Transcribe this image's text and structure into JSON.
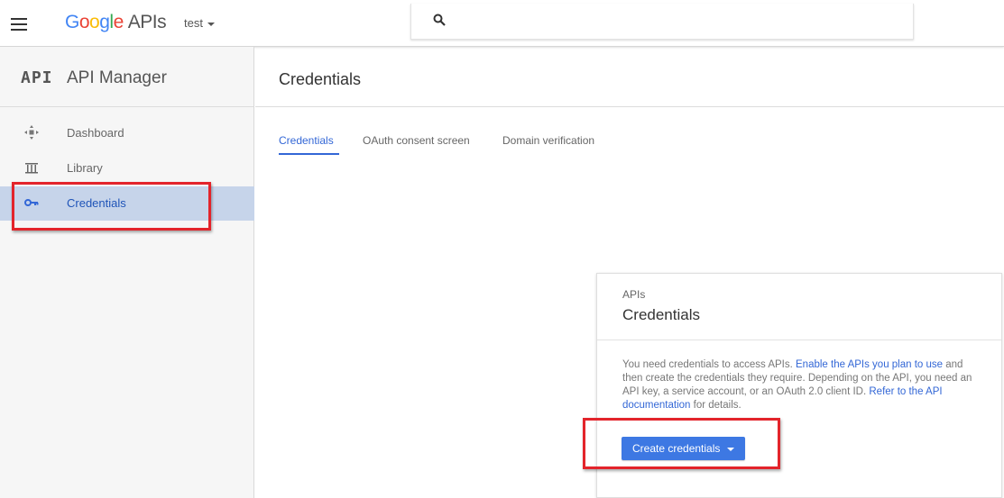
{
  "header": {
    "logo_parts": [
      "G",
      "o",
      "o",
      "g",
      "l",
      "e"
    ],
    "logo_suffix": "APIs",
    "project": "test"
  },
  "sidebar": {
    "logo_text": "API",
    "title": "API Manager",
    "items": [
      {
        "label": "Dashboard",
        "icon": "dashboard-icon"
      },
      {
        "label": "Library",
        "icon": "library-icon"
      },
      {
        "label": "Credentials",
        "icon": "key-icon",
        "active": true
      }
    ]
  },
  "main": {
    "title": "Credentials",
    "tabs": [
      {
        "label": "Credentials",
        "active": true
      },
      {
        "label": "OAuth consent screen"
      },
      {
        "label": "Domain verification"
      }
    ]
  },
  "card": {
    "overline": "APIs",
    "title": "Credentials",
    "text_1": "You need credentials to access APIs. ",
    "link_1": "Enable the APIs you plan to use",
    "text_2": " and then create the credentials they require. Depending on the API, you need an API key, a service account, or an OAuth 2.0 client ID. ",
    "link_2": "Refer to the API documentation",
    "text_3": " for details.",
    "button_label": "Create credentials"
  },
  "colors": {
    "accent": "#3367d6",
    "button": "#3d78e3",
    "highlight": "#e3242b",
    "active_nav_bg": "#c6d4ea"
  }
}
